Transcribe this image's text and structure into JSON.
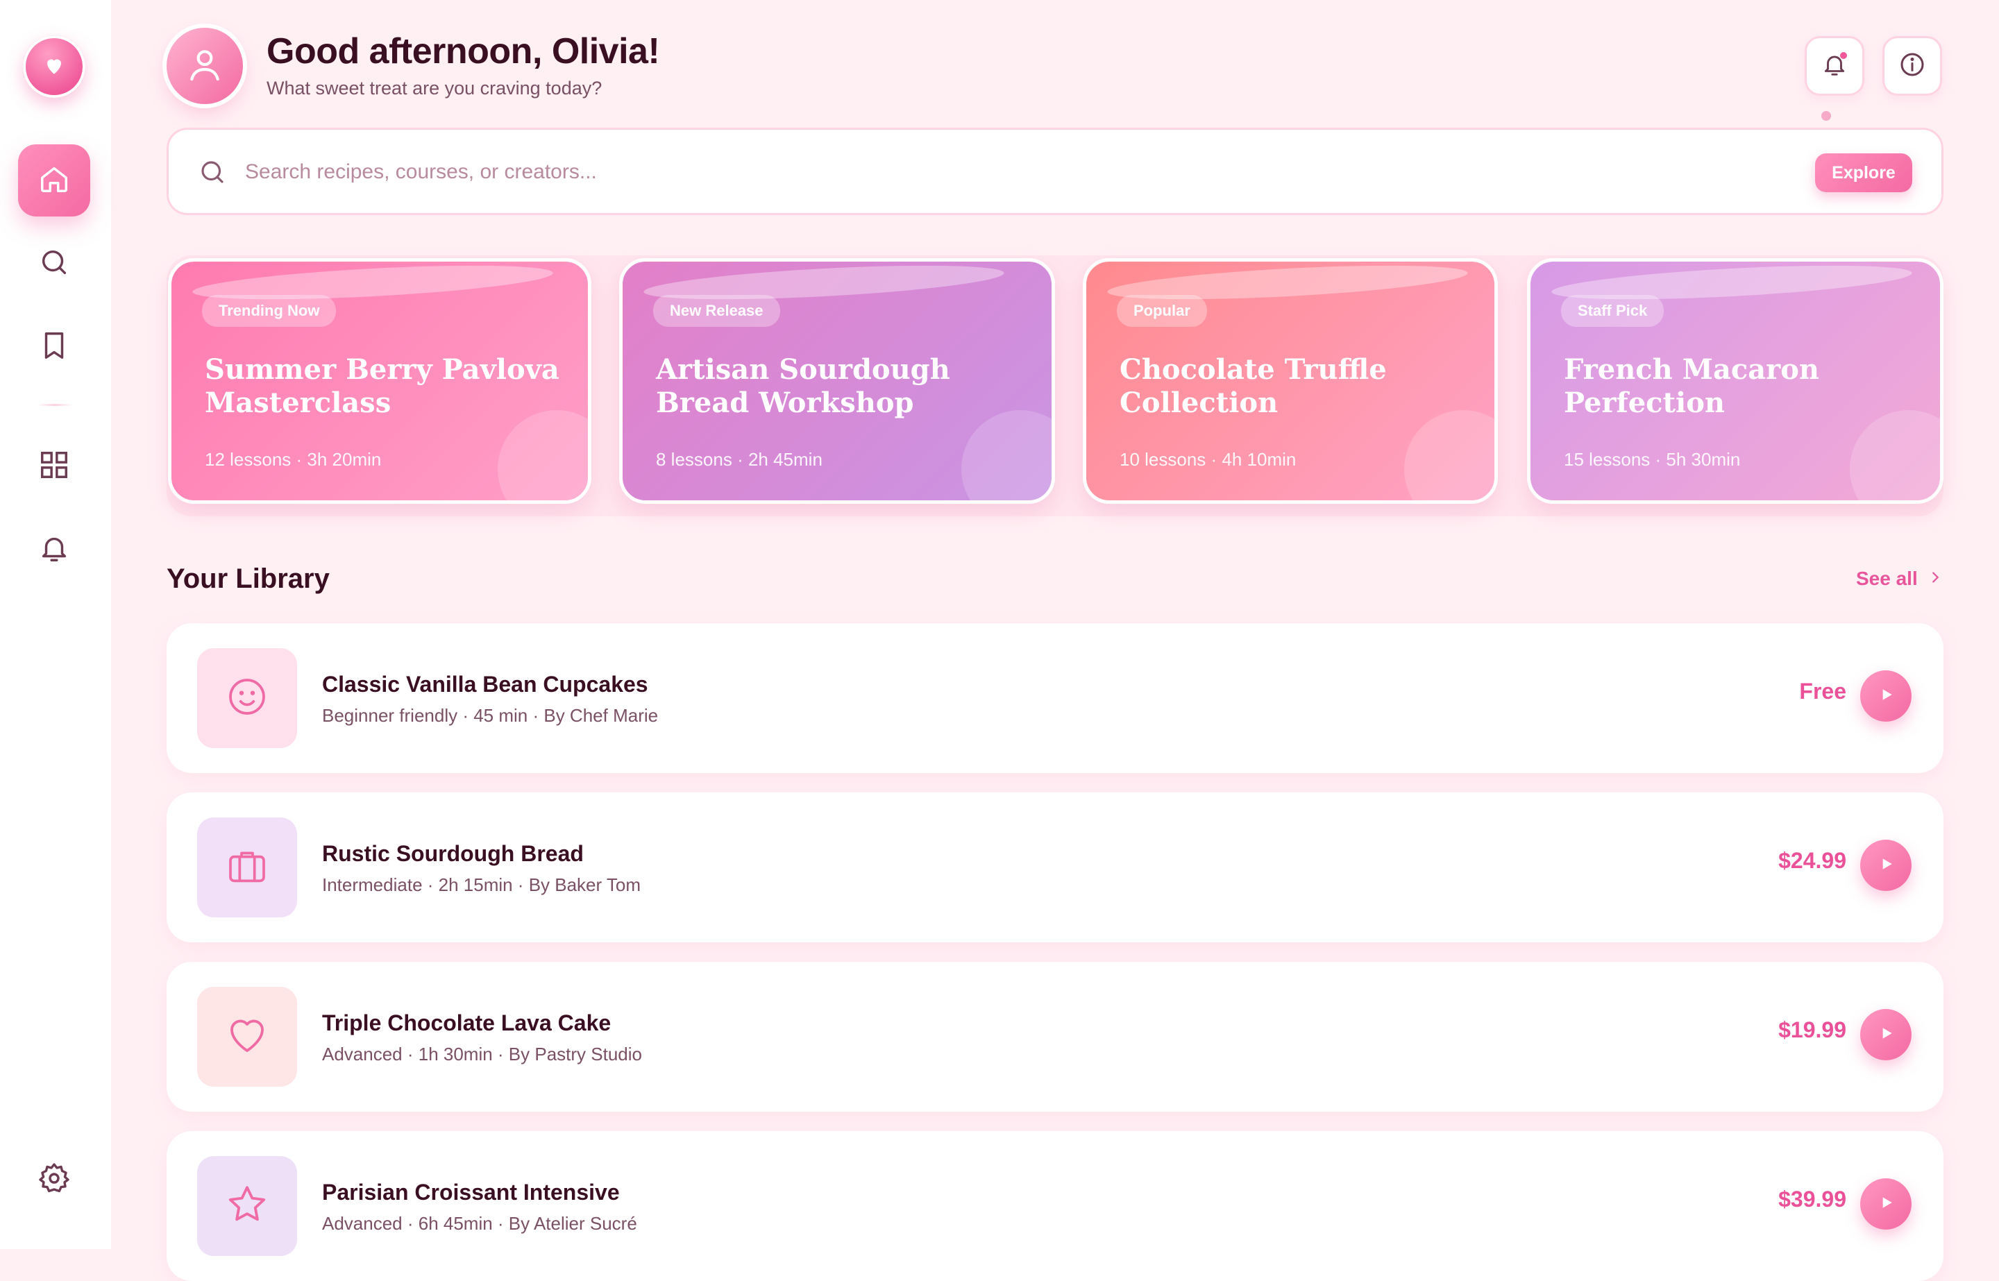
{
  "colors": {
    "accent": "#f46aa3",
    "accent_light": "#ff8fbb",
    "background": "#fff0f4",
    "text_dark": "#3a0f22",
    "text_muted": "#7a5064"
  },
  "sidebar": {
    "logo_icon": "heart-pin-icon",
    "items": [
      {
        "icon": "home-icon",
        "active": true
      },
      {
        "icon": "search-icon",
        "active": false
      },
      {
        "icon": "bookmark-icon",
        "active": false
      },
      {
        "icon": "grid-icon",
        "active": false
      },
      {
        "icon": "bell-icon",
        "active": false
      }
    ],
    "bottom_icon": "settings-icon"
  },
  "header": {
    "greeting": "Good afternoon, Olivia!",
    "subtitle": "What sweet treat are you craving today?",
    "actions": [
      {
        "icon": "bell-icon",
        "has_dot": true
      },
      {
        "icon": "info-icon",
        "has_dot": false
      }
    ]
  },
  "search": {
    "placeholder": "Search recipes, courses, or creators...",
    "value": "",
    "button_label": "Explore"
  },
  "featured": [
    {
      "tag": "Trending Now",
      "title": "Summer Berry Pavlova Masterclass",
      "meta": "12 lessons · 3h 20min",
      "gradient": [
        "#ff7bb0",
        "#ff9fc8"
      ]
    },
    {
      "tag": "New Release",
      "title": "Artisan Sourdough Bread Workshop",
      "meta": "8 lessons · 2h 45min",
      "gradient": [
        "#e37fc8",
        "#c995e4"
      ]
    },
    {
      "tag": "Popular",
      "title": "Chocolate Truffle Collection",
      "meta": "10 lessons · 4h 10min",
      "gradient": [
        "#ff8a8e",
        "#ffa3c6"
      ]
    },
    {
      "tag": "Staff Pick",
      "title": "French Macaron Perfection",
      "meta": "15 lessons · 5h 30min",
      "gradient": [
        "#d79ae6",
        "#f3a9d6"
      ]
    }
  ],
  "library": {
    "title": "Your Library",
    "see_all": "See all",
    "items": [
      {
        "icon": "smile-icon",
        "thumb_bg": "#ffe0ec",
        "title": "Classic Vanilla Bean Cupcakes",
        "meta": "Beginner friendly · 45 min · By Chef Marie",
        "price": "Free"
      },
      {
        "icon": "briefcase-icon",
        "thumb_bg": "#f1e0f7",
        "title": "Rustic Sourdough Bread",
        "meta": "Intermediate · 2h 15min · By Baker Tom",
        "price": "$24.99"
      },
      {
        "icon": "heart-icon",
        "thumb_bg": "#ffe6e6",
        "title": "Triple Chocolate Lava Cake",
        "meta": "Advanced · 1h 30min · By Pastry Studio",
        "price": "$19.99"
      },
      {
        "icon": "star-icon",
        "thumb_bg": "#ede0f7",
        "title": "Parisian Croissant Intensive",
        "meta": "Advanced · 6h 45min · By Atelier Sucré",
        "price": "$39.99"
      }
    ]
  }
}
